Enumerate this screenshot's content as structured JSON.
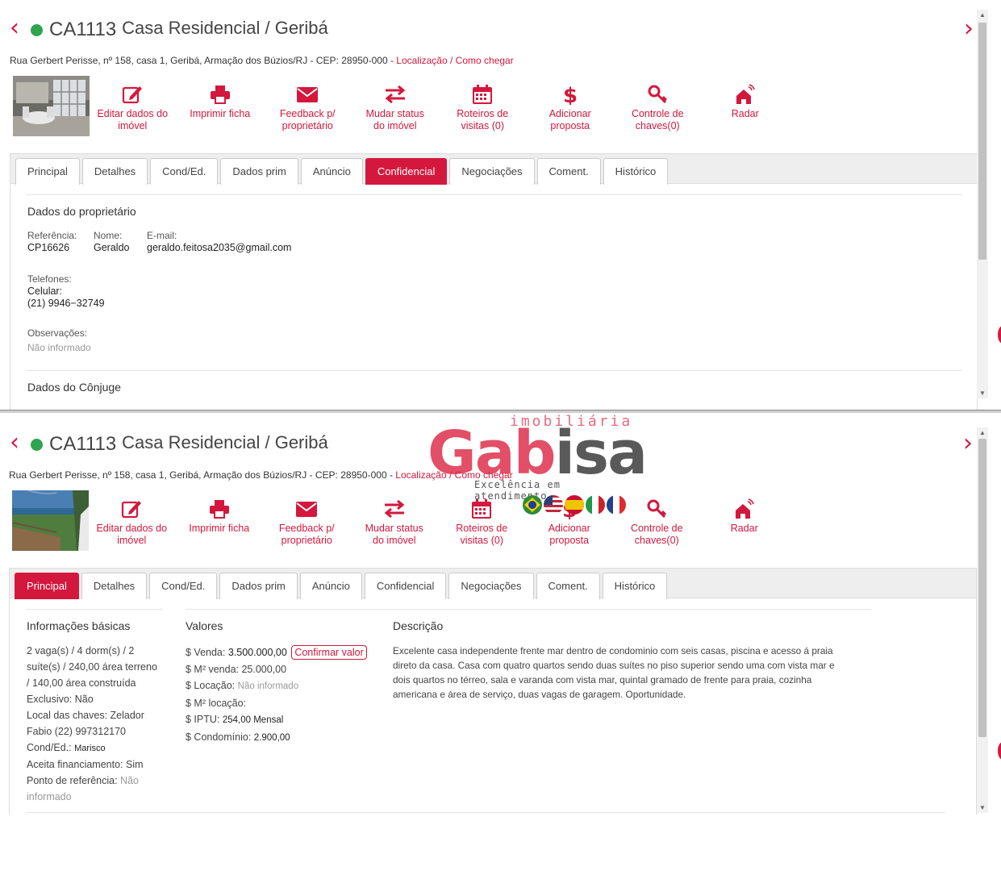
{
  "property": {
    "code": "CA1113",
    "title": "Casa Residencial / Geribá",
    "address": "Rua Gerbert Perisse, nº 158, casa 1, Geribá, Armação dos Búzios/RJ - CEP: 28950-000 - ",
    "map_link": "Localização",
    "map_sep": " / ",
    "route_link": "Como chegar"
  },
  "actions": [
    {
      "icon": "edit-icon",
      "line1": "Editar dados do",
      "line2": "imóvel"
    },
    {
      "icon": "print-icon",
      "line1": "Imprimir ficha",
      "line2": ""
    },
    {
      "icon": "envelope-icon",
      "line1": "Feedback p/",
      "line2": "proprietário"
    },
    {
      "icon": "exchange-icon",
      "line1": "Mudar status",
      "line2": "do imóvel"
    },
    {
      "icon": "calendar-icon",
      "line1": "Roteiros de",
      "line2": "visitas (0)"
    },
    {
      "icon": "dollar-icon",
      "line1": "Adicionar",
      "line2": "proposta"
    },
    {
      "icon": "key-icon",
      "line1": "Controle de",
      "line2": "chaves(0)"
    },
    {
      "icon": "radar-icon",
      "line1": "Radar",
      "line2": ""
    }
  ],
  "tabs": [
    "Principal",
    "Detalhes",
    "Cond/Ed.",
    "Dados prim",
    "Anúncio",
    "Confidencial",
    "Negociações",
    "Coment.",
    "Histórico"
  ],
  "top_view": {
    "active_tab": "Confidencial",
    "owner_section": "Dados do proprietário",
    "ref_label": "Referência:",
    "ref_value": "CP16626",
    "name_label": "Nome:",
    "name_value": "Geraldo",
    "email_label": "E-mail:",
    "email_value": "geraldo.feitosa2035@gmail.com",
    "phones_label": "Telefones:",
    "mobile_label": "Celular:",
    "mobile_value": "(21) 9946−32749",
    "notes_label": "Observações:",
    "notes_value": "Não informado",
    "spouse_section": "Dados do Cônjuge"
  },
  "bottom_view": {
    "active_tab": "Principal",
    "basic_title": "Informações básicas",
    "basic_lines": [
      "2 vaga(s) / 4 dorm(s) / 2",
      "suíte(s) / 240,00 área terreno",
      "/ 140,00 área construída",
      "Exclusivo: Não",
      "Local das chaves: Zelador",
      "Fabio (22) 997312170"
    ],
    "cond_label": "Cond/Ed.:",
    "cond_value": "Marisco",
    "financing": "Aceita financiamento: Sim",
    "reference_label": "Ponto de referência:",
    "reference_value1": "Não",
    "reference_value2": "informado",
    "values_title": "Valores",
    "sale_label": "$ Venda:",
    "sale_value": "3.500.000,00",
    "confirm_button": "Confirmar valor",
    "m2_sale": "$ M² venda: 25.000,00",
    "rent_label": "$ Locação:",
    "rent_value": "Não informado",
    "m2_rent": "$ M² locação:",
    "iptu_label": "$ IPTU:",
    "iptu_value": "254,00 Mensal",
    "condo_label": "$ Condomínio:",
    "condo_value": "2.900,00",
    "desc_title": "Descrição",
    "desc_lines": [
      "Excelente casa independente frente mar dentro de condominio com seis casas, piscina e acesso á praia",
      "direto da casa. Casa com quatro quartos sendo duas suítes no piso superior sendo uma com vista mar e",
      "dois quartos no térreo, sala e varanda com vista mar, quintal gramado de frente para praia, cozinha",
      "americana e área de serviço, duas vagas de garagem. Oportunidade."
    ]
  },
  "watermark": {
    "top": "imobiliária",
    "brand_left": "Gab",
    "brand_right": "isa",
    "tagline": "Excelência em atendimento"
  },
  "colors": {
    "accent": "#d4183d",
    "status": "#2ea44f"
  }
}
